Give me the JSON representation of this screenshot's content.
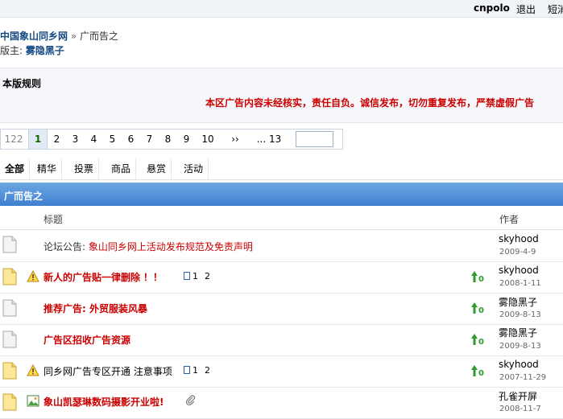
{
  "topbar": {
    "username": "cnpolo",
    "logout": "退出",
    "messages": "短消"
  },
  "breadcrumb": {
    "site": "中国象山同乡网",
    "separator": "»",
    "current": "广而告之"
  },
  "moderator": {
    "label": "版主:",
    "name": "雾隐黑子"
  },
  "rules": {
    "title": "本版规则",
    "notice": "本区广告内容未经核实，责任自负。诚信发布，切勿重复发布，严禁虚假广告"
  },
  "pager": {
    "total": "122",
    "pages": [
      "1",
      "2",
      "3",
      "4",
      "5",
      "6",
      "7",
      "8",
      "9",
      "10"
    ],
    "current": "1",
    "next": "››",
    "last": "... 13"
  },
  "tabs": [
    {
      "label": "全部"
    },
    {
      "label": "精华"
    },
    {
      "label": "投票"
    },
    {
      "label": "商品"
    },
    {
      "label": "悬赏"
    },
    {
      "label": "活动"
    }
  ],
  "forum_title": "广而告之",
  "columns": {
    "title": "标题",
    "author": "作者"
  },
  "threads": [
    {
      "prefix": "论坛公告:",
      "title": "象山同乡网上活动发布规范及免责声明",
      "author": "skyhood",
      "date": "2009-4-9"
    },
    {
      "title": "新人的广告贴一律删除",
      "excl": "！！",
      "pages": [
        "1",
        "2"
      ],
      "author": "skyhood",
      "date": "2008-1-11"
    },
    {
      "title": "推荐广告: 外贸服装风暴",
      "author": "雾隐黑子",
      "date": "2009-8-13"
    },
    {
      "title": "广告区招收广告资源",
      "author": "雾隐黑子",
      "date": "2009-8-13"
    },
    {
      "title": "同乡网广告专区开通 注意事项",
      "pages": [
        "1",
        "2"
      ],
      "author": "skyhood",
      "date": "2007-11-29"
    },
    {
      "title": "象山凯瑟琳数码摄影开业啦!",
      "author": "孔雀开屏",
      "date": "2008-11-7"
    }
  ],
  "colors": {
    "accent": "#3e7fcf",
    "link": "#164a84",
    "red": "#cc0000",
    "up_arrow": "#2e9b2e"
  }
}
